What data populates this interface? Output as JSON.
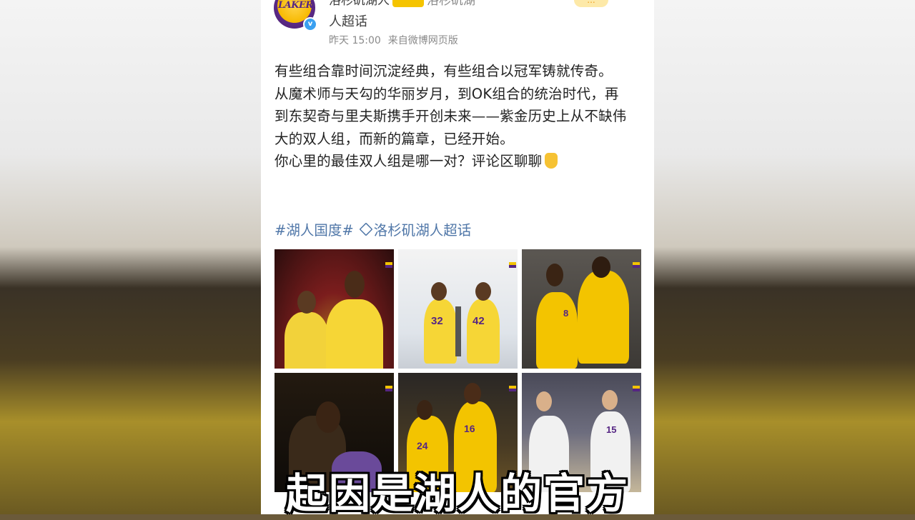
{
  "post": {
    "author_name_line1": "洛杉矶湖人",
    "author_name_tail": "洛杉矶湖",
    "author_name_line2": "人超话",
    "avatar_text": "LAKERS",
    "follow_label": "...",
    "time": "昨天 15:00",
    "source": "来自微博网页版",
    "paragraphs": [
      "有些组合靠时间沉淀经典，有些组合以冠军铸就传奇。",
      "从魔术师与天勾的华丽岁月，到OK组合的统治时代，再到东契奇与里夫斯携手开创未来——紫金历史上从不缺伟大的双人组，而新的篇章，已经开始。",
      "你心里的最佳双人组是哪一对？评论区聊聊"
    ],
    "hashtag": "#湖人国度#",
    "super_topic": "洛杉矶湖人超话"
  },
  "images": [
    {
      "jerseys": [
        "",
        ""
      ]
    },
    {
      "jerseys": [
        "32",
        "42"
      ]
    },
    {
      "jerseys": [
        "8",
        ""
      ]
    },
    {
      "jerseys": [
        "",
        ""
      ]
    },
    {
      "jerseys": [
        "24",
        "16"
      ]
    },
    {
      "jerseys": [
        "",
        "15"
      ]
    }
  ],
  "subtitle": "起因是湖人的官方",
  "colors": {
    "lakers_gold": "#f3c400",
    "lakers_purple": "#552583",
    "link_blue": "#5077a8"
  }
}
